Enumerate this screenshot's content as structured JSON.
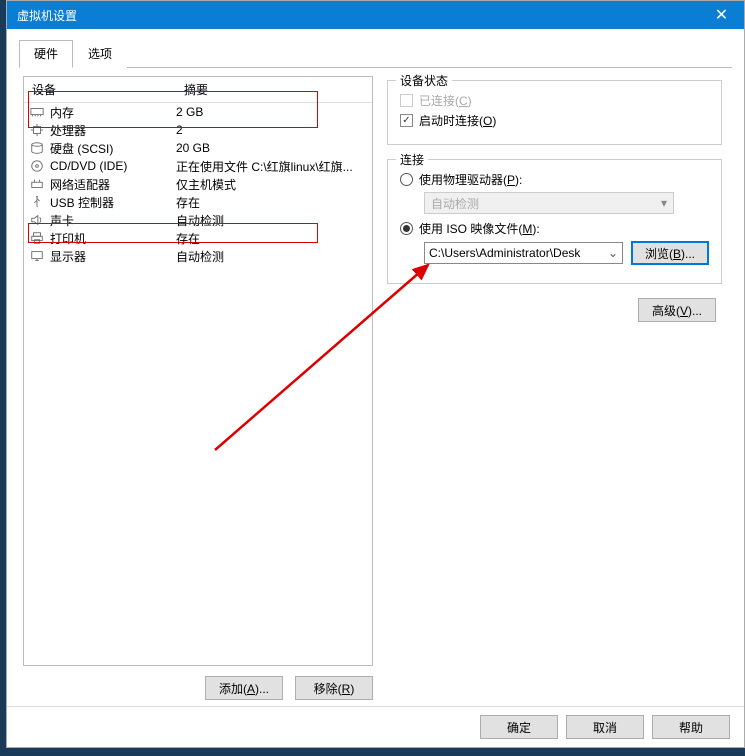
{
  "title": "虚拟机设置",
  "tabs": {
    "hardware": "硬件",
    "options": "选项"
  },
  "headers": {
    "device": "设备",
    "summary": "摘要"
  },
  "devices": [
    {
      "name": "内存",
      "summary": "2 GB",
      "icon": "memory"
    },
    {
      "name": "处理器",
      "summary": "2",
      "icon": "cpu"
    },
    {
      "name": "硬盘 (SCSI)",
      "summary": "20 GB",
      "icon": "disk"
    },
    {
      "name": "CD/DVD (IDE)",
      "summary": "正在使用文件 C:\\红旗linux\\红旗...",
      "icon": "cd"
    },
    {
      "name": "网络适配器",
      "summary": "仅主机模式",
      "icon": "net"
    },
    {
      "name": "USB 控制器",
      "summary": "存在",
      "icon": "usb"
    },
    {
      "name": "声卡",
      "summary": "自动检测",
      "icon": "sound"
    },
    {
      "name": "打印机",
      "summary": "存在",
      "icon": "print"
    },
    {
      "name": "显示器",
      "summary": "自动检测",
      "icon": "display"
    }
  ],
  "left_buttons": {
    "add": "添加(A)...",
    "remove": "移除(R)"
  },
  "device_status": {
    "title": "设备状态",
    "connected": "已连接(C)",
    "connect_at_power": "启动时连接(O)"
  },
  "connection": {
    "title": "连接",
    "use_physical": "使用物理驱动器(P):",
    "physical_value": "自动检测",
    "use_iso": "使用 ISO 映像文件(M):",
    "iso_path": "C:\\Users\\Administrator\\Desk",
    "browse": "浏览(B)...",
    "advanced": "高级(V)..."
  },
  "footer": {
    "ok": "确定",
    "cancel": "取消",
    "help": "帮助"
  }
}
